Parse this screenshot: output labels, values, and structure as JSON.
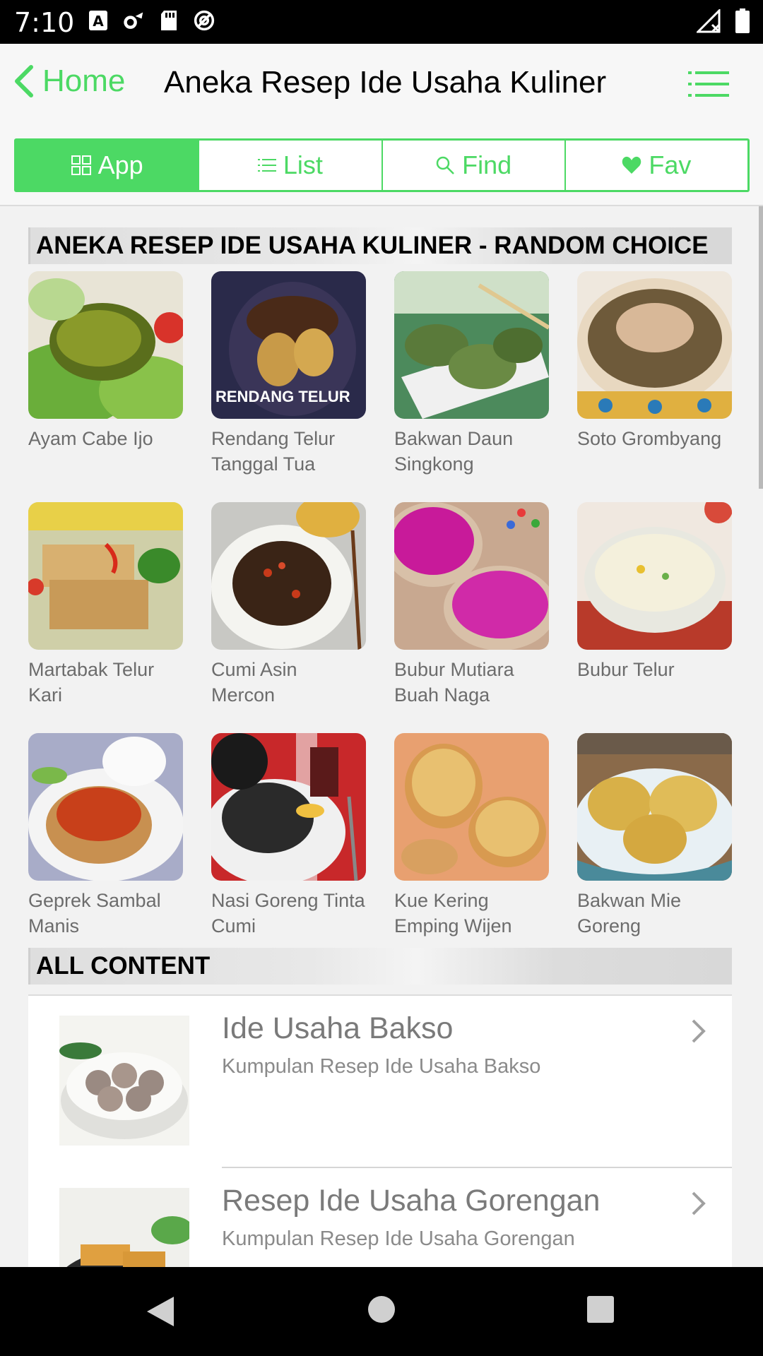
{
  "status": {
    "time": "7:10"
  },
  "header": {
    "back_label": "Home",
    "title": "Aneka Resep Ide Usaha Kuliner"
  },
  "tabs": [
    {
      "label": "App",
      "icon": "grid-icon",
      "active": true
    },
    {
      "label": "List",
      "icon": "list-icon",
      "active": false
    },
    {
      "label": "Find",
      "icon": "search-icon",
      "active": false
    },
    {
      "label": "Fav",
      "icon": "heart-icon",
      "active": false
    }
  ],
  "random": {
    "heading": "ANEKA RESEP IDE USAHA KULINER - RANDOM CHOICE",
    "items": [
      {
        "name": "Ayam Cabe Ijo"
      },
      {
        "name": "Rendang Telur Tanggal Tua"
      },
      {
        "name": "Bakwan Daun Singkong"
      },
      {
        "name": "Soto Grombyang"
      },
      {
        "name": "Martabak Telur Kari"
      },
      {
        "name": "Cumi Asin Mercon"
      },
      {
        "name": "Bubur Mutiara Buah Naga"
      },
      {
        "name": "Bubur Telur"
      },
      {
        "name": "Geprek Sambal Manis"
      },
      {
        "name": "Nasi Goreng Tinta Cumi"
      },
      {
        "name": "Kue Kering Emping Wijen"
      },
      {
        "name": "Bakwan Mie Goreng"
      }
    ],
    "thumb_text": "RENDANG TELUR"
  },
  "all_content": {
    "heading": "ALL CONTENT",
    "items": [
      {
        "title": "Ide Usaha Bakso",
        "subtitle": "Kumpulan Resep Ide Usaha Bakso"
      },
      {
        "title": "Resep Ide Usaha Gorengan",
        "subtitle": "Kumpulan Resep Ide Usaha Gorengan"
      }
    ]
  },
  "colors": {
    "accent": "#4cd964",
    "header_bg": "#f7f7f7",
    "list_text": "#7a7a7a"
  }
}
